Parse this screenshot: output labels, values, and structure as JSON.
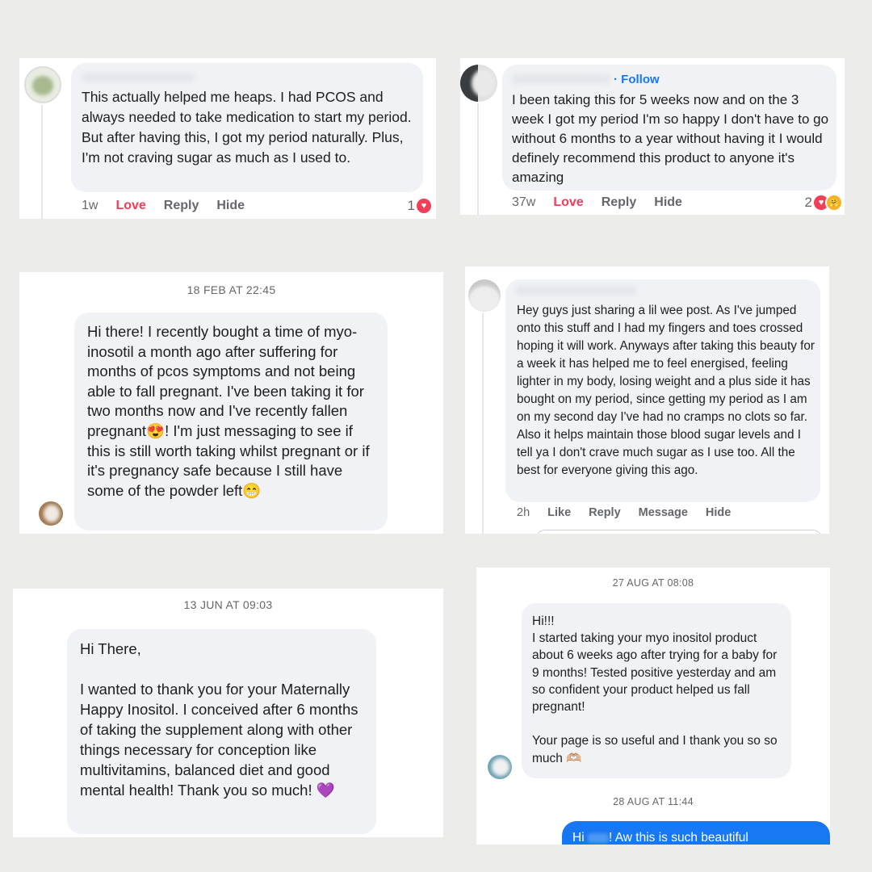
{
  "c1": {
    "comment": "This actually helped me heaps. I had PCOS and always needed to take medication to start my period. But after having this, I got my period naturally. Plus, I'm not craving sugar as much as I used to.",
    "time": "1w",
    "love": "Love",
    "reply": "Reply",
    "hide": "Hide",
    "count": "1"
  },
  "c2": {
    "follow": "· Follow",
    "comment": "I been taking this for 5 weeks now and on the 3 week I got my period I'm so happy I don't have to go without 6 months to a year without having it I would definely recommend this product to anyone it's amazing",
    "time": "37w",
    "love": "Love",
    "reply": "Reply",
    "hide": "Hide",
    "count": "2"
  },
  "c3": {
    "timestamp": "18 FEB AT 22:45",
    "message": "Hi there! I recently bought a time of myo-inosotil a month ago after suffering for months of pcos symptoms and not being able to fall pregnant. I've been taking it for two months now and I've recently fallen pregnant😍! I'm just messaging to see if this is still worth taking whilst pregnant or if it's pregnancy safe because I still have some of the powder left😁"
  },
  "c4": {
    "comment": "Hey guys just sharing a lil wee post. As I've jumped onto this stuff and I had my fingers and toes crossed hoping it will work. Anyways after taking this beauty for a week it has helped me to feel energised, feeling lighter in my body, losing weight and a plus side it has bought on my period, since getting my period as I am on my second day I've had no cramps no clots so far. Also it helps maintain those blood sugar levels and I tell ya I don't crave much sugar as I use too. All the best for everyone giving this ago.",
    "time": "2h",
    "like": "Like",
    "reply": "Reply",
    "message": "Message",
    "hide": "Hide"
  },
  "c5": {
    "timestamp": "13 JUN AT 09:03",
    "message": "Hi There,\n\nI wanted to thank you for your Maternally Happy Inositol. I conceived after 6 months of taking the supplement along with other things necessary for conception like multivitamins, balanced diet and good mental health! Thank you so much! 💜"
  },
  "c6": {
    "timestamp": "27 AUG AT 08:08",
    "message": "Hi!!!\nI started taking your myo inositol product about 6 weeks ago after trying for a baby for 9 months! Tested positive yesterday and am so confident your product helped us fall pregnant!\n\nYour page is so useful and I thank you so so much 🫶🏼",
    "timestamp2": "28 AUG AT 11:44",
    "reply_start": "Hi ",
    "reply_end": "! Aw this is such beautiful"
  }
}
